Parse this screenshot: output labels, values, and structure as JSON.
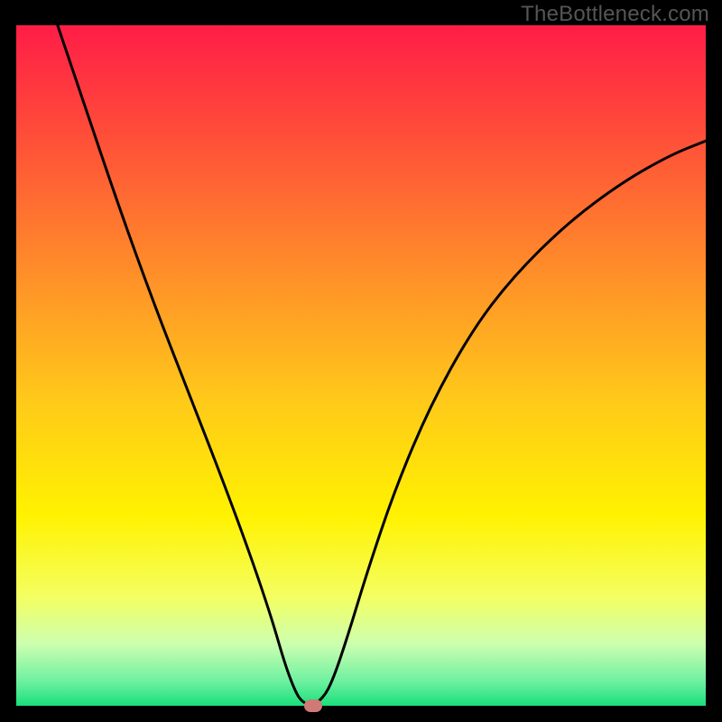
{
  "watermark": "TheBottleneck.com",
  "colors": {
    "background": "#000000",
    "curve": "#000000",
    "marker": "#cf7a77",
    "gradient_stops": [
      {
        "offset": 0.0,
        "color": "#ff1d47"
      },
      {
        "offset": 0.15,
        "color": "#ff4a3a"
      },
      {
        "offset": 0.35,
        "color": "#ff8a2a"
      },
      {
        "offset": 0.55,
        "color": "#ffc91a"
      },
      {
        "offset": 0.72,
        "color": "#fff200"
      },
      {
        "offset": 0.84,
        "color": "#f4ff61"
      },
      {
        "offset": 0.91,
        "color": "#ccffb0"
      },
      {
        "offset": 0.965,
        "color": "#6cf0a0"
      },
      {
        "offset": 1.0,
        "color": "#18e07a"
      }
    ]
  },
  "chart_data": {
    "type": "line",
    "title": "",
    "xlabel": "",
    "ylabel": "",
    "xlim": [
      0,
      100
    ],
    "ylim": [
      0,
      100
    ],
    "grid": false,
    "min_marker": {
      "x": 43,
      "y": 0
    },
    "series": [
      {
        "name": "bottleneck-curve",
        "segments": [
          {
            "name": "left",
            "points": [
              {
                "x": 6,
                "y": 100
              },
              {
                "x": 10,
                "y": 88
              },
              {
                "x": 15,
                "y": 73
              },
              {
                "x": 20,
                "y": 59
              },
              {
                "x": 25,
                "y": 46
              },
              {
                "x": 30,
                "y": 33
              },
              {
                "x": 34,
                "y": 22
              },
              {
                "x": 37,
                "y": 13
              },
              {
                "x": 39,
                "y": 6
              },
              {
                "x": 40.5,
                "y": 2
              },
              {
                "x": 41.5,
                "y": 0.5
              },
              {
                "x": 43,
                "y": 0
              }
            ]
          },
          {
            "name": "right",
            "points": [
              {
                "x": 43,
                "y": 0
              },
              {
                "x": 44.5,
                "y": 1
              },
              {
                "x": 46,
                "y": 4
              },
              {
                "x": 48,
                "y": 10
              },
              {
                "x": 51,
                "y": 20
              },
              {
                "x": 55,
                "y": 32
              },
              {
                "x": 60,
                "y": 44
              },
              {
                "x": 66,
                "y": 55
              },
              {
                "x": 72,
                "y": 63
              },
              {
                "x": 80,
                "y": 71
              },
              {
                "x": 88,
                "y": 77
              },
              {
                "x": 95,
                "y": 81
              },
              {
                "x": 100,
                "y": 83
              }
            ]
          }
        ]
      }
    ]
  }
}
